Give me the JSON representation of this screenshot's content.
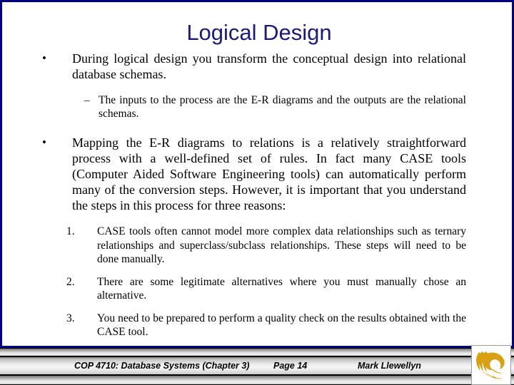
{
  "slide": {
    "title": "Logical Design",
    "title_color": "#1a1a78",
    "border_color": "#000080",
    "background_color": "#ffffff"
  },
  "body": {
    "bullet_marker": "•",
    "dash_marker": "–",
    "bullet1": "During logical design you transform the conceptual design into relational database schemas.",
    "sub1": "The inputs to the process are the E-R diagrams and the outputs are the relational schemas.",
    "bullet2": "Mapping the E-R diagrams to relations is a relatively straightforward process with a well-defined set of rules.  In fact many CASE tools (Computer Aided Software Engineering tools) can automatically perform many of the conversion steps.  However, it is important that you understand the steps in this process for three reasons:",
    "numbered": [
      {
        "number": "1.",
        "text": "CASE tools often cannot model more complex data relationships such as ternary relationships and superclass/subclass relationships.   These steps will need to be done manually."
      },
      {
        "number": "2.",
        "text": "There are some legitimate alternatives where you must manually chose an alternative."
      },
      {
        "number": "3.",
        "text": "You need to be prepared to perform a quality check on the results obtained with the CASE tool."
      }
    ]
  },
  "footer": {
    "course": "COP 4710: Database Systems  (Chapter 3)",
    "page": "Page 14",
    "author": "Mark Llewellyn",
    "logo_name": "pegasus-logo",
    "logo_color": "#D8A012"
  }
}
